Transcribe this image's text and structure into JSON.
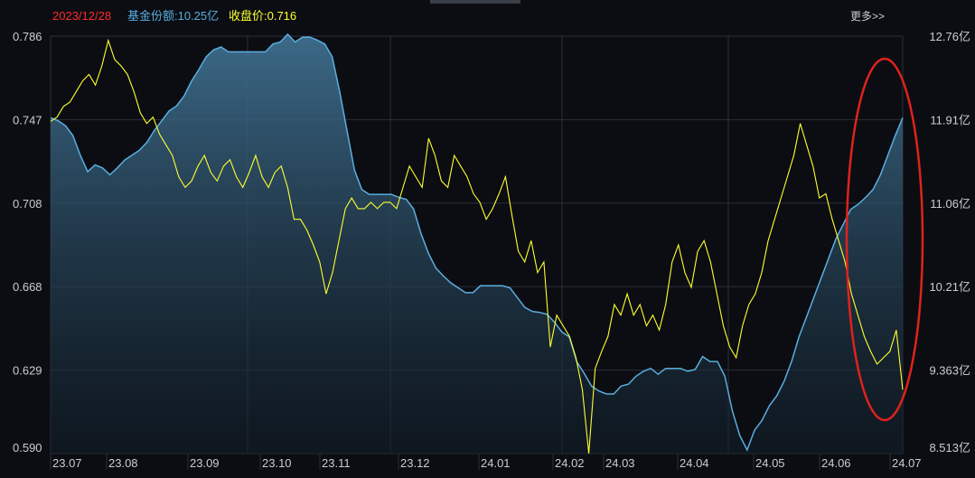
{
  "header": {
    "date": "2023/12/28",
    "fund_share_label": "基金份额:10.25亿",
    "close_price_label": "收盘价:0.716",
    "more_label": "更多>>"
  },
  "colors": {
    "background": "#0b0d12",
    "grid": "#2b2f38",
    "fund_share": "#5aaee0",
    "close_price": "#ffff2e",
    "date_text": "#ff2a2a",
    "annotation": "#e0221c"
  },
  "chart_data": {
    "type": "line",
    "title": "",
    "xlabel": "",
    "ylabel": "",
    "legend": "top-left",
    "grid": true,
    "x_ticks": [
      "23.07",
      "23.08",
      "23.09",
      "23.10",
      "23.11",
      "23.12",
      "24.01",
      "24.02",
      "24.03",
      "24.04",
      "24.05",
      "24.06",
      "24.07"
    ],
    "y_left_ticks": [
      "0.786",
      "0.747",
      "0.708",
      "0.668",
      "0.629",
      "0.590"
    ],
    "y_right_ticks": [
      "12.76亿",
      "11.91亿",
      "11.06亿",
      "10.21亿",
      "9.363亿",
      "8.513亿"
    ],
    "y_left_range": [
      0.59,
      0.786
    ],
    "y_right_range": [
      8.513,
      12.76
    ],
    "series": [
      {
        "name": "收盘价",
        "axis": "left",
        "values": [
          0.746,
          0.748,
          0.753,
          0.755,
          0.76,
          0.765,
          0.768,
          0.763,
          0.772,
          0.784,
          0.775,
          0.772,
          0.768,
          0.76,
          0.75,
          0.745,
          0.748,
          0.74,
          0.735,
          0.73,
          0.72,
          0.715,
          0.718,
          0.725,
          0.73,
          0.722,
          0.718,
          0.725,
          0.728,
          0.72,
          0.715,
          0.722,
          0.73,
          0.72,
          0.715,
          0.722,
          0.725,
          0.715,
          0.7,
          0.7,
          0.695,
          0.688,
          0.68,
          0.665,
          0.675,
          0.69,
          0.705,
          0.71,
          0.705,
          0.705,
          0.708,
          0.705,
          0.708,
          0.708,
          0.705,
          0.715,
          0.725,
          0.72,
          0.715,
          0.738,
          0.73,
          0.718,
          0.715,
          0.73,
          0.725,
          0.72,
          0.712,
          0.708,
          0.7,
          0.705,
          0.712,
          0.72,
          0.702,
          0.685,
          0.68,
          0.69,
          0.675,
          0.68,
          0.64,
          0.655,
          0.65,
          0.645,
          0.635,
          0.62,
          0.59,
          0.63,
          0.638,
          0.645,
          0.66,
          0.655,
          0.665,
          0.655,
          0.66,
          0.65,
          0.655,
          0.648,
          0.66,
          0.68,
          0.688,
          0.675,
          0.668,
          0.685,
          0.69,
          0.68,
          0.665,
          0.65,
          0.64,
          0.635,
          0.65,
          0.66,
          0.665,
          0.675,
          0.69,
          0.7,
          0.71,
          0.72,
          0.73,
          0.745,
          0.735,
          0.725,
          0.71,
          0.712,
          0.7,
          0.69,
          0.68,
          0.665,
          0.655,
          0.645,
          0.638,
          0.632,
          0.635,
          0.638,
          0.648,
          0.62
        ]
      },
      {
        "name": "基金份额",
        "axis": "right",
        "values": [
          11.93,
          11.9,
          11.85,
          11.75,
          11.55,
          11.38,
          11.45,
          11.42,
          11.35,
          11.42,
          11.5,
          11.55,
          11.6,
          11.68,
          11.8,
          11.9,
          12.0,
          12.05,
          12.15,
          12.3,
          12.42,
          12.55,
          12.62,
          12.65,
          12.6,
          12.6,
          12.6,
          12.6,
          12.6,
          12.6,
          12.68,
          12.7,
          12.78,
          12.7,
          12.75,
          12.75,
          12.72,
          12.68,
          12.55,
          12.2,
          11.8,
          11.4,
          11.2,
          11.15,
          11.15,
          11.15,
          11.15,
          11.12,
          11.1,
          11.0,
          10.75,
          10.55,
          10.4,
          10.32,
          10.25,
          10.2,
          10.15,
          10.15,
          10.22,
          10.22,
          10.22,
          10.22,
          10.2,
          10.1,
          10.0,
          9.96,
          9.95,
          9.93,
          9.85,
          9.75,
          9.7,
          9.45,
          9.33,
          9.2,
          9.15,
          9.12,
          9.12,
          9.2,
          9.22,
          9.3,
          9.35,
          9.38,
          9.32,
          9.38,
          9.38,
          9.38,
          9.35,
          9.37,
          9.5,
          9.45,
          9.45,
          9.3,
          8.95,
          8.7,
          8.55,
          8.75,
          8.85,
          9.0,
          9.1,
          9.25,
          9.45,
          9.7,
          9.9,
          10.1,
          10.3,
          10.5,
          10.7,
          10.85,
          11.0,
          11.05,
          11.12,
          11.2,
          11.35,
          11.55,
          11.75,
          11.93
        ]
      }
    ]
  }
}
